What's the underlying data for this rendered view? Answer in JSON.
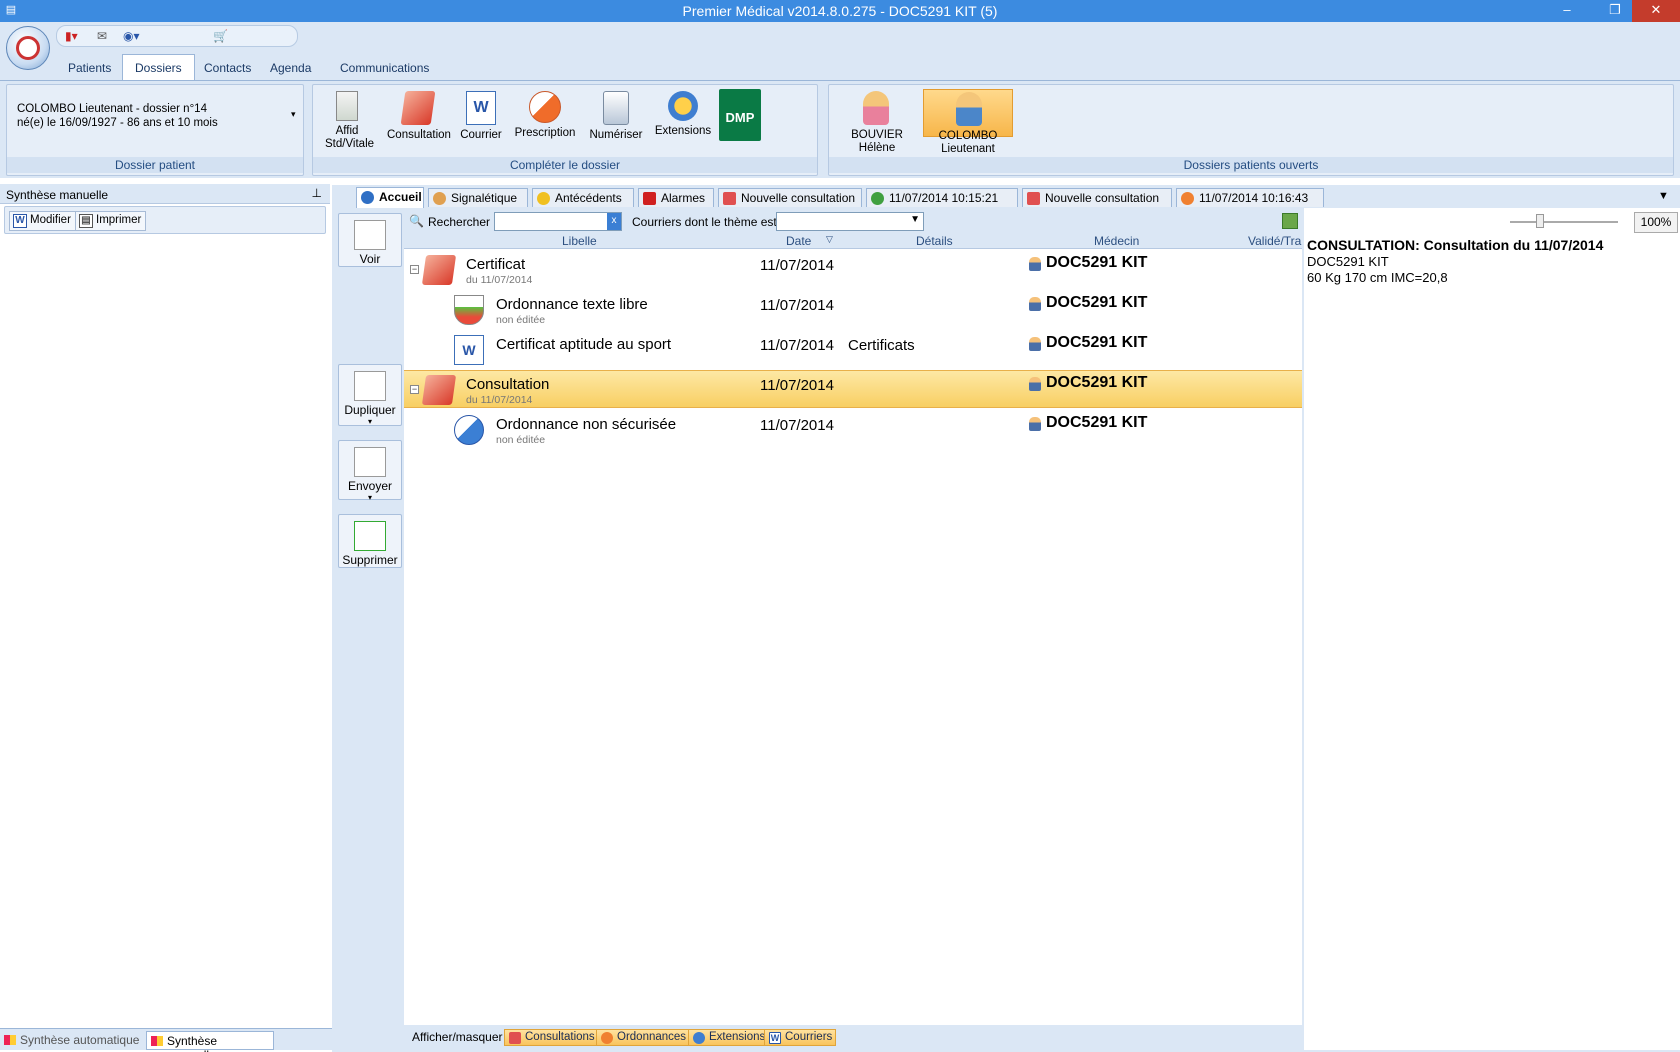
{
  "window": {
    "title": "Premier Médical v2014.8.0.275 - DOC5291 KIT (5)"
  },
  "ribbon": {
    "tabs": [
      "Patients",
      "Dossiers",
      "Contacts",
      "Agenda",
      "Communications"
    ],
    "active_tab": "Dossiers",
    "patient_group": {
      "line1": "COLOMBO Lieutenant - dossier n°14",
      "line2": "né(e) le 16/09/1927 - 86 ans et 10 mois",
      "label": "Dossier patient"
    },
    "complete_group": {
      "label": "Compléter le dossier",
      "buttons": [
        "Affid",
        "Std/Vitale",
        "Consultation",
        "Courrier",
        "Prescription",
        "Numériser",
        "Extensions",
        "DMP"
      ]
    },
    "open_group": {
      "label": "Dossiers patients ouverts",
      "patients": [
        {
          "name": "BOUVIER",
          "first": "Hélène",
          "active": false
        },
        {
          "name": "COLOMBO",
          "first": "Lieutenant",
          "active": true
        }
      ]
    }
  },
  "left_pane": {
    "title": "Synthèse manuelle",
    "pin": "⊥",
    "modifier": "Modifier",
    "imprimer": "Imprimer",
    "bottom_tabs": [
      "Synthèse automatique",
      "Synthèse manuelle"
    ]
  },
  "doc_tabs": [
    {
      "label": "Accueil",
      "active": true,
      "color": "#2f6fc5"
    },
    {
      "label": "Signalétique",
      "active": false,
      "color": "#e0a050"
    },
    {
      "label": "Antécédents",
      "active": false,
      "color": "#f0c020"
    },
    {
      "label": "Alarmes",
      "active": false,
      "color": "#d02020"
    },
    {
      "label": "Nouvelle consultation",
      "active": false,
      "color": "#e05050"
    },
    {
      "label": "11/07/2014 10:15:21",
      "active": false,
      "color": "#40a040"
    },
    {
      "label": "Nouvelle consultation",
      "active": false,
      "color": "#e05050"
    },
    {
      "label": "11/07/2014 10:16:43",
      "active": false,
      "color": "#f08030"
    }
  ],
  "side_actions": [
    "Voir",
    "Dupliquer",
    "Envoyer",
    "Supprimer"
  ],
  "list_toolbar": {
    "search_label": "Rechercher",
    "clear": "x",
    "theme_label": "Courriers dont le thème est",
    "theme_value": ""
  },
  "columns": {
    "libelle": "Libelle",
    "date": "Date",
    "details": "Détails",
    "medecin": "Médecin",
    "valide": "Validé/Trai"
  },
  "rows": [
    {
      "label": "Certificat",
      "sub": "du 11/07/2014",
      "date": "11/07/2014",
      "details": "",
      "doctor": "DOC5291 KIT"
    },
    {
      "label": "Ordonnance texte libre",
      "sub": "non éditée",
      "date": "11/07/2014",
      "details": "",
      "doctor": "DOC5291 KIT"
    },
    {
      "label": "Certificat aptitude au sport",
      "sub": "",
      "date": "11/07/2014",
      "details": "Certificats",
      "doctor": "DOC5291 KIT"
    },
    {
      "label": "Consultation",
      "sub": "du 11/07/2014",
      "date": "11/07/2014",
      "details": "",
      "doctor": "DOC5291 KIT"
    },
    {
      "label": "Ordonnance non sécurisée",
      "sub": "non éditée",
      "date": "11/07/2014",
      "details": "",
      "doctor": "DOC5291 KIT"
    }
  ],
  "bottom_filters": {
    "label": "Afficher/masquer",
    "items": [
      "Consultations",
      "Ordonnances",
      "Extensions",
      "Courriers"
    ]
  },
  "preview": {
    "zoom": "100%",
    "title": "CONSULTATION: Consultation du 11/07/2014",
    "doctor": "DOC5291 KIT",
    "vitals": "60 Kg 170 cm  IMC=20,8"
  }
}
